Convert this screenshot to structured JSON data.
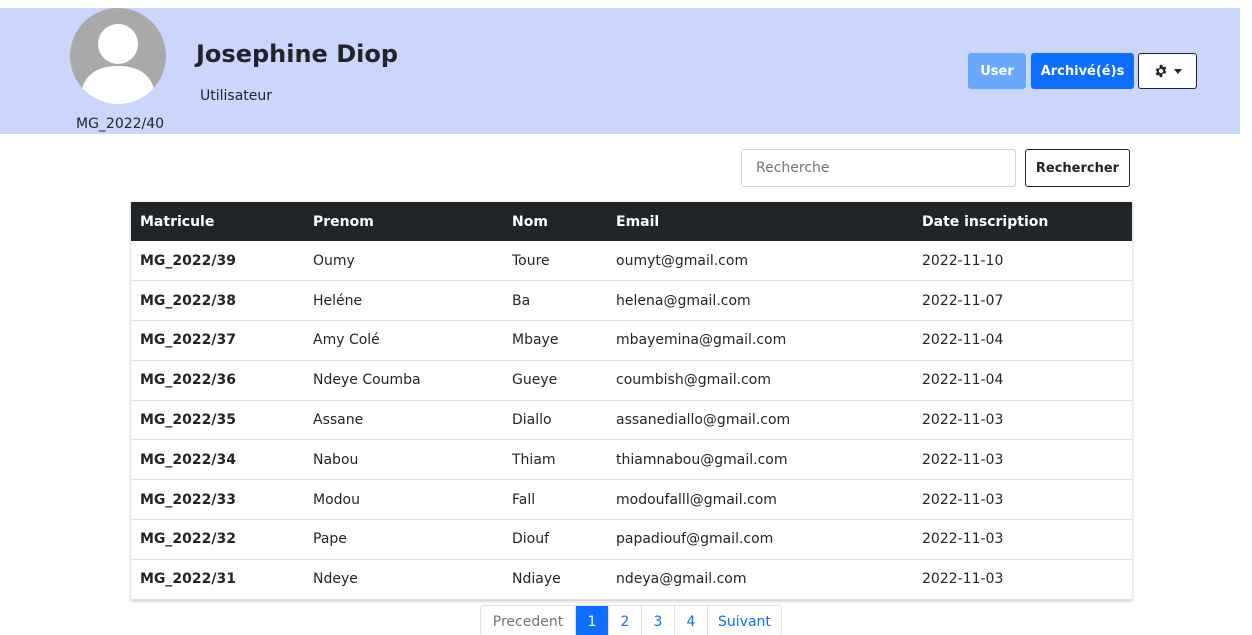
{
  "profile": {
    "name": "Josephine Diop",
    "role": "Utilisateur",
    "id": "MG_2022/40",
    "avatar_icon": "user-avatar-icon"
  },
  "toolbar": {
    "user_label": "User",
    "archive_label": "Archivé(é)s",
    "settings_icon": "gear-icon"
  },
  "search": {
    "placeholder": "Recherche",
    "value": "",
    "button_label": "Rechercher"
  },
  "table": {
    "headers": [
      "Matricule",
      "Prenom",
      "Nom",
      "Email",
      "Date inscription"
    ],
    "rows": [
      [
        "MG_2022/39",
        "Oumy",
        "Toure",
        "oumyt@gmail.com",
        "2022-11-10"
      ],
      [
        "MG_2022/38",
        "Heléne",
        "Ba",
        "helena@gmail.com",
        "2022-11-07"
      ],
      [
        "MG_2022/37",
        "Amy Colé",
        "Mbaye",
        "mbayemina@gmail.com",
        "2022-11-04"
      ],
      [
        "MG_2022/36",
        "Ndeye Coumba",
        "Gueye",
        "coumbish@gmail.com",
        "2022-11-04"
      ],
      [
        "MG_2022/35",
        "Assane",
        "Diallo",
        "assanediallo@gmail.com",
        "2022-11-03"
      ],
      [
        "MG_2022/34",
        "Nabou",
        "Thiam",
        "thiamnabou@gmail.com",
        "2022-11-03"
      ],
      [
        "MG_2022/33",
        "Modou",
        "Fall",
        "modoufalll@gmail.com",
        "2022-11-03"
      ],
      [
        "MG_2022/32",
        "Pape",
        "Diouf",
        "papadiouf@gmail.com",
        "2022-11-03"
      ],
      [
        "MG_2022/31",
        "Ndeye",
        "Ndiaye",
        "ndeya@gmail.com",
        "2022-11-03"
      ]
    ]
  },
  "pagination": {
    "prev_label": "Precedent",
    "pages": [
      "1",
      "2",
      "3",
      "4"
    ],
    "active_page": "1",
    "next_label": "Suivant"
  },
  "colors": {
    "header_bg": "#cbd6fd",
    "primary": "#0d6efd",
    "primary_light": "#6aa8fb",
    "table_header_bg": "#212529"
  }
}
